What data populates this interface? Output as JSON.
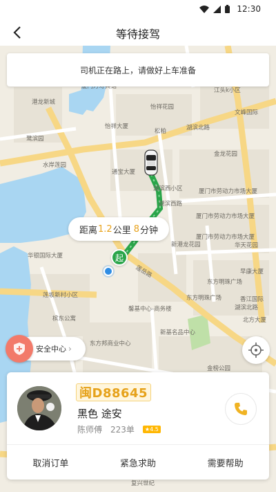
{
  "status_bar": {
    "time": "12:30",
    "icons": [
      "wifi-icon",
      "signal-icon",
      "battery-icon"
    ]
  },
  "header": {
    "title": "等待接驾",
    "back_icon": "chevron-left-icon"
  },
  "notice": {
    "text": "司机正在路上，请做好上车准备"
  },
  "distance": {
    "prefix": "距离",
    "km": "1.2",
    "km_unit": "公里",
    "min": "8",
    "min_unit": "分钟"
  },
  "start_marker": {
    "label": "起"
  },
  "map_labels": [
    "港龙新城",
    "厦门万寿宾馆",
    "怡祥花园",
    "怡祥大厦",
    "松柏",
    "湖滨北路",
    "江头k小区",
    "文峰国际",
    "鹭滨园",
    "水岸莲园",
    "通宝大厦",
    "金龙花园",
    "厦门市劳动力市场大厦",
    "湖滨西小区",
    "湖滨西路",
    "厦门市劳动力市场大厦",
    "厦门市劳动力市场大厦",
    "新港龙花园",
    "华天花园",
    "华银国际大厦",
    "东方明珠广场",
    "莲岳路",
    "莲坂新村小区",
    "东方明珠广场",
    "馨基中心-商务楼",
    "北方大厦",
    "槟东公寓",
    "东方邦商业中心",
    "新基名品中心",
    "香江国际",
    "湖滨北路",
    "金榜公园",
    "早康大厦",
    "复兴世纪"
  ],
  "safety": {
    "label": "安全中心",
    "icon": "shield-plus-icon"
  },
  "locate": {
    "icon": "crosshair-icon"
  },
  "driver": {
    "plate": "闽D88645",
    "car_desc": "黑色 途安",
    "name": "陈师傅",
    "orders": "223单",
    "rating": "★4.5"
  },
  "actions": [
    "取消订单",
    "紧急求助",
    "需要帮助"
  ],
  "colors": {
    "accent": "#e8a21b",
    "route": "#2aa54a",
    "water": "#a9d6f2",
    "safety": "#f27a6a"
  }
}
